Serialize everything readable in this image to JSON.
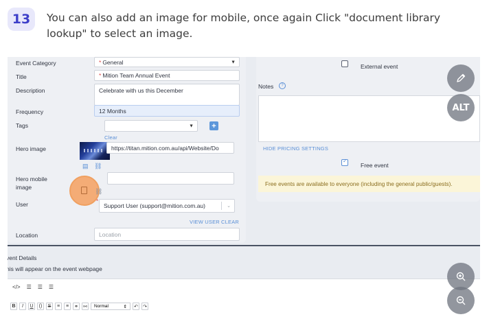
{
  "step": {
    "number": "13",
    "text": "You can also add an image for mobile, once again Click \"document library lookup\" to select an image."
  },
  "form": {
    "event_category": {
      "label": "Event Category",
      "value": "General"
    },
    "title": {
      "label": "Title",
      "value": "Mition Team Annual Event"
    },
    "description": {
      "label": "Description",
      "value": "Celebrate with us this December"
    },
    "frequency": {
      "label": "Frequency",
      "value": "12 Months"
    },
    "tags": {
      "label": "Tags",
      "clear_link": "Clear"
    },
    "hero_image": {
      "label": "Hero image",
      "url": "https://titan.mition.com.au/api/Website/Do"
    },
    "hero_mobile": {
      "label_line1": "Hero mobile",
      "label_line2": "image"
    },
    "user": {
      "label": "User",
      "value": "Support User (support@mition.com.au)",
      "view_link": "VIEW USER",
      "clear_link": "CLEAR"
    },
    "location": {
      "label": "Location",
      "placeholder": "Location"
    }
  },
  "right_panel": {
    "external_event": "External event",
    "notes_label": "Notes",
    "hide_pricing": "HIDE PRICING SETTINGS",
    "free_event": "Free event",
    "free_note": "Free events are available to everyone (including the general public/guests)."
  },
  "details": {
    "title": "Event Details",
    "subtitle": "This will appear on the event webpage",
    "visible_title": "vent Details",
    "visible_subtitle": "his will appear on the event webpage",
    "format_select": "Normal"
  },
  "fabs": {
    "alt": "ALT"
  },
  "colors": {
    "accent": "#5a8fd6",
    "highlight": "#f5a05f",
    "badge_bg": "#e8e8fb",
    "badge_fg": "#3d3fc9"
  }
}
